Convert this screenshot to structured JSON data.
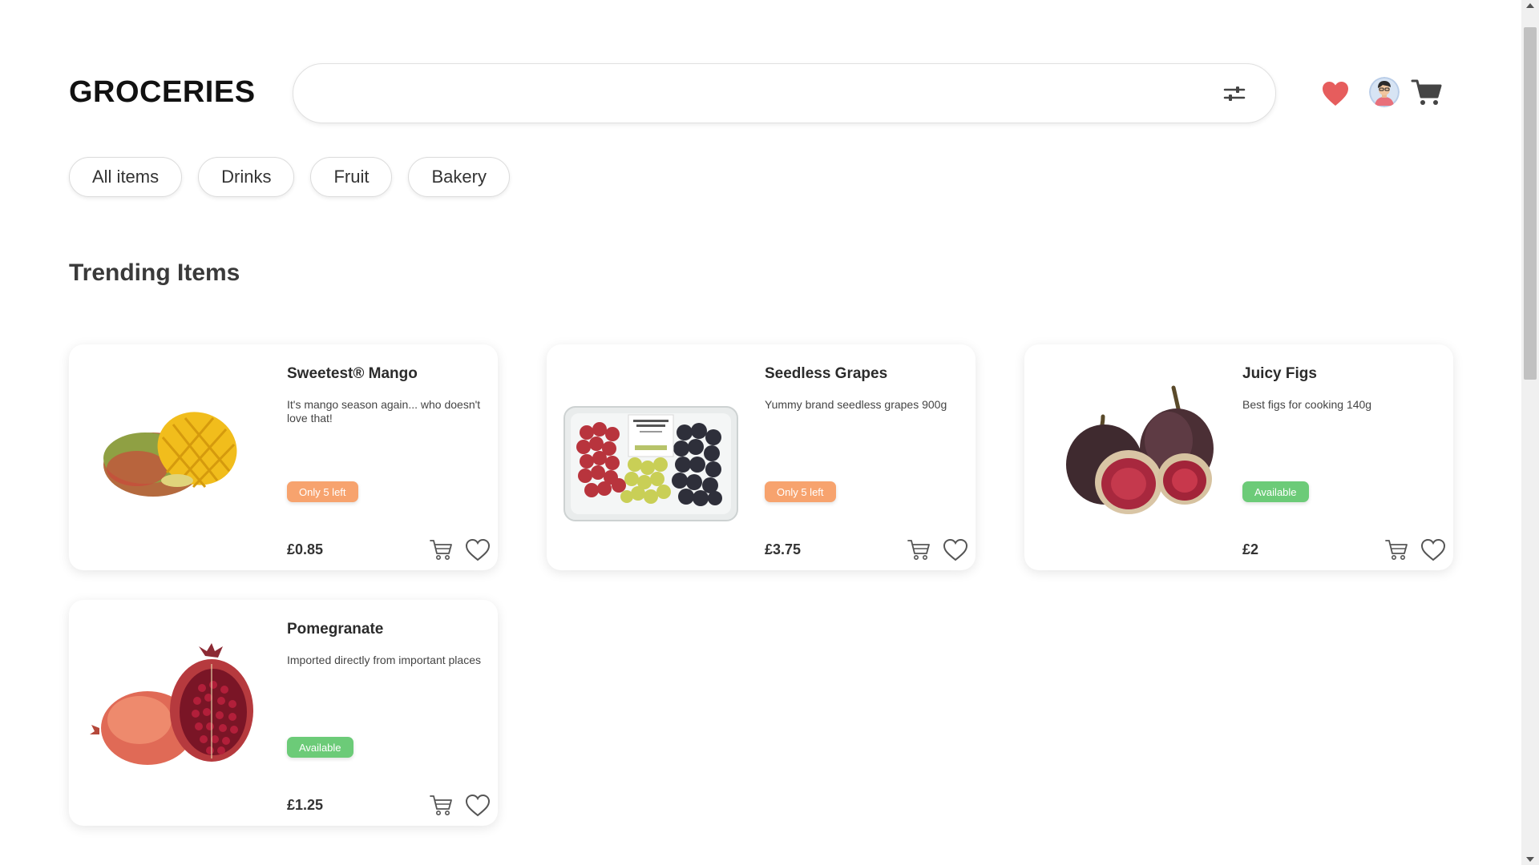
{
  "header": {
    "logo": "GROCERIES",
    "search": {
      "value": "",
      "placeholder": ""
    },
    "icons": [
      "filter-icon",
      "heart-icon",
      "avatar",
      "cart-icon"
    ]
  },
  "categories": [
    "All items",
    "Drinks",
    "Fruit",
    "Bakery"
  ],
  "section_title": "Trending Items",
  "products": [
    {
      "name": "Sweetest® Mango",
      "description": "It's mango season again... who doesn't love that!",
      "badge": "Only 5 left",
      "price": "£0.85"
    },
    {
      "name": "Seedless Grapes",
      "description": "Yummy brand seedless grapes 900g",
      "badge": "Only 5 left",
      "price": "£3.75"
    },
    {
      "name": "Juicy Figs",
      "description": "Best figs for cooking 140g",
      "badge": "Available",
      "price": "£2"
    },
    {
      "name": "Pomegranate",
      "description": "Imported directly from important places",
      "badge": "Available",
      "price": "£1.25"
    }
  ],
  "colors": {
    "badge_low_stock": "#f7a36e",
    "badge_available": "#6ccb78",
    "heart_active": "#e65d5d"
  }
}
